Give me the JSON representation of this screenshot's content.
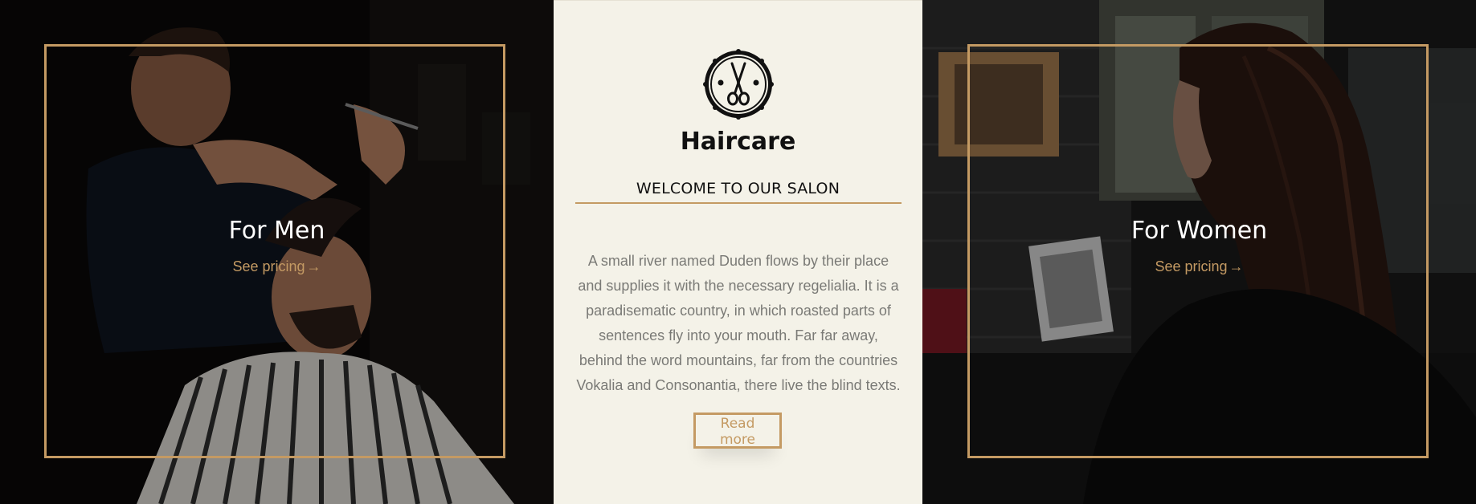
{
  "men_card": {
    "title": "For Men",
    "link_label": "See pricing",
    "arrow": "→"
  },
  "center": {
    "logo_icon": "scissors-badge-icon",
    "brand": "Haircare",
    "welcome": "WELCOME TO OUR SALON",
    "description": "A small river named Duden flows by their place and supplies it with the necessary regelialia. It is a paradisematic country, in which roasted parts of sentences fly into your mouth. Far far away, behind the word mountains, far from the countries Vokalia and Consonantia, there live the blind texts.",
    "button_label": "Read more"
  },
  "women_card": {
    "title": "For Women",
    "link_label": "See pricing",
    "arrow": "→"
  },
  "colors": {
    "accent": "#c49a63",
    "center_bg": "#f4f2e8",
    "text_muted": "#7a7a76"
  }
}
